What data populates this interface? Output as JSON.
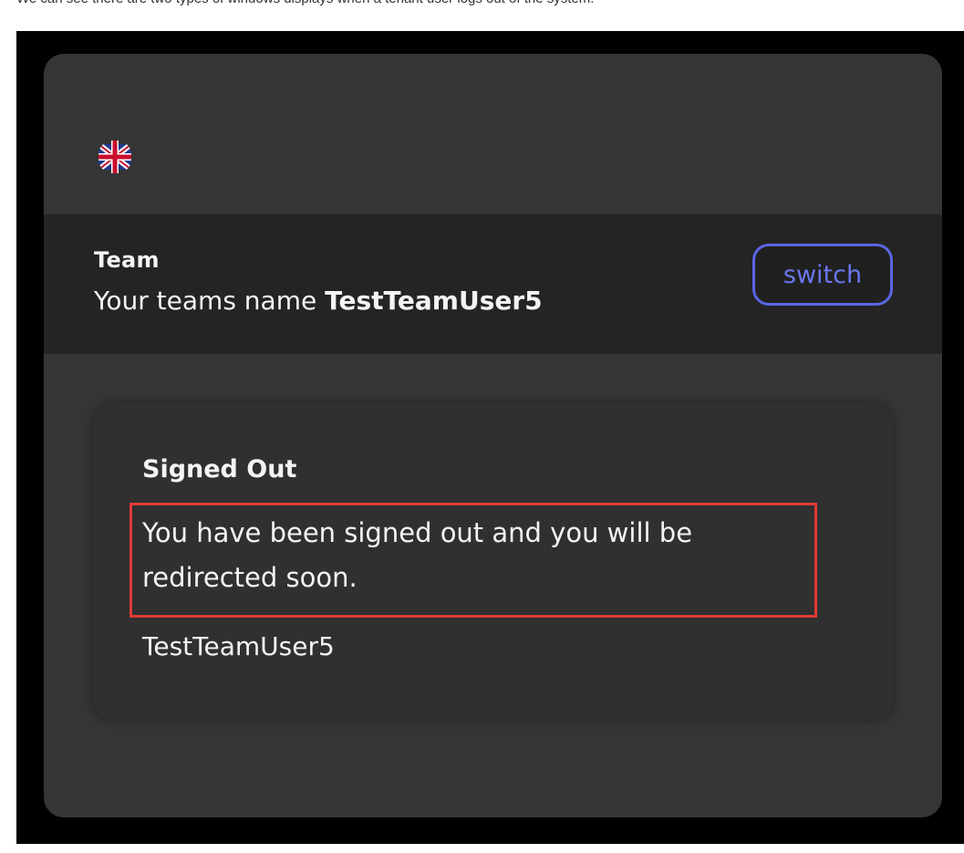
{
  "caption": "We can see there are two types of windows displays when a tenant user logs out of the system.",
  "language": {
    "flag_icon": "uk-flag-icon"
  },
  "team": {
    "title": "Team",
    "name_prefix": "Your teams name ",
    "name": "TestTeamUser5",
    "switch_label": "switch"
  },
  "status": {
    "title": "Signed Out",
    "message": "You have been signed out and you will be redirected soon.",
    "user": "TestTeamUser5"
  },
  "colors": {
    "accent": "#5a66e4",
    "highlight": "#e03a35",
    "card_bg": "#353535",
    "team_bar_bg": "#242424"
  }
}
